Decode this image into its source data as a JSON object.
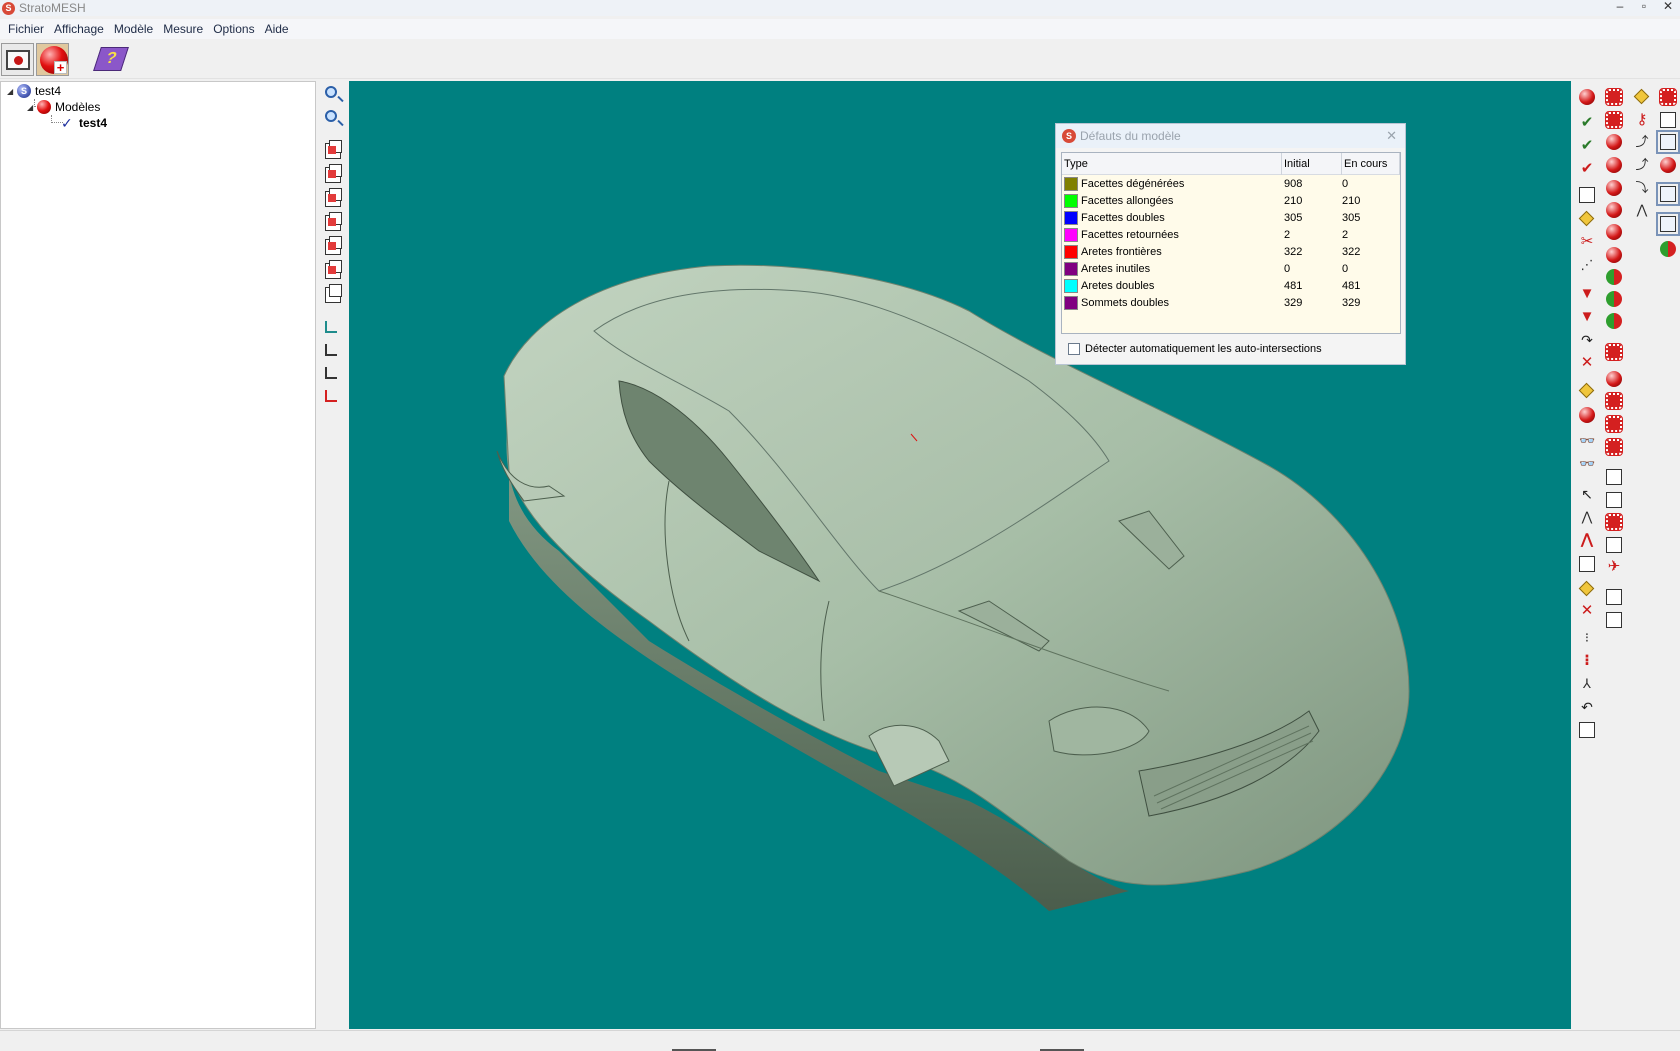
{
  "window": {
    "title": "StratoMESH",
    "controls": [
      "–",
      "▫",
      "✕"
    ]
  },
  "menu": [
    "Fichier",
    "Affichage",
    "Modèle",
    "Mesure",
    "Options",
    "Aide"
  ],
  "tree": {
    "root": "test4",
    "group": "Modèles",
    "model": "test4"
  },
  "dialog": {
    "title": "Défauts du modèle",
    "close": "✕",
    "columns": {
      "type": "Type",
      "initial": "Initial",
      "current": "En cours"
    },
    "rows": [
      {
        "label": "Facettes dégénérées",
        "initial": "908",
        "current": "0",
        "color": "#808000"
      },
      {
        "label": "Facettes allongées",
        "initial": "210",
        "current": "210",
        "color": "#00ff00"
      },
      {
        "label": "Facettes doubles",
        "initial": "305",
        "current": "305",
        "color": "#0000ff"
      },
      {
        "label": "Facettes retournées",
        "initial": "2",
        "current": "2",
        "color": "#ff00ff"
      },
      {
        "label": "Aretes frontières",
        "initial": "322",
        "current": "322",
        "color": "#ff0000"
      },
      {
        "label": "Aretes inutiles",
        "initial": "0",
        "current": "0",
        "color": "#800080"
      },
      {
        "label": "Aretes doubles",
        "initial": "481",
        "current": "481",
        "color": "#00ffff"
      },
      {
        "label": "Sommets doubles",
        "initial": "329",
        "current": "329",
        "color": "#800080"
      }
    ],
    "auto_intersect_label": "Détecter automatiquement les auto-intersections"
  },
  "colors": {
    "viewport_bg": "#008080",
    "model_fill": "#a9bfa9"
  }
}
